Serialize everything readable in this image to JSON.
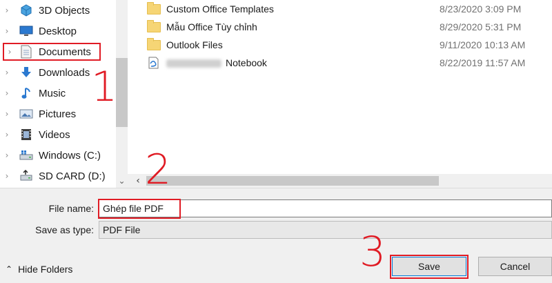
{
  "nav": {
    "items": [
      {
        "label": "3D Objects",
        "icon": "3d-objects-icon"
      },
      {
        "label": "Desktop",
        "icon": "desktop-icon"
      },
      {
        "label": "Documents",
        "icon": "documents-icon"
      },
      {
        "label": "Downloads",
        "icon": "downloads-icon"
      },
      {
        "label": "Music",
        "icon": "music-icon"
      },
      {
        "label": "Pictures",
        "icon": "pictures-icon"
      },
      {
        "label": "Videos",
        "icon": "videos-icon"
      },
      {
        "label": "Windows (C:)",
        "icon": "drive-icon"
      },
      {
        "label": "SD CARD (D:)",
        "icon": "sd-card-icon"
      }
    ],
    "selected": "Documents"
  },
  "files": [
    {
      "name": "Custom Office Templates",
      "date": "8/23/2020 3:09 PM",
      "type": "folder"
    },
    {
      "name": "Mẫu Office Tùy chỉnh",
      "date": "8/29/2020 5:31 PM",
      "type": "folder"
    },
    {
      "name": "Outlook Files",
      "date": "9/11/2020 10:13 AM",
      "type": "folder"
    },
    {
      "name": "Notebook",
      "date": "8/22/2019 11:57 AM",
      "type": "notebook"
    }
  ],
  "form": {
    "file_name_label": "File name:",
    "file_name_value": "Ghép file PDF",
    "save_as_type_label": "Save as type:",
    "save_as_type_value": "PDF File",
    "hide_folders": "Hide Folders",
    "save": "Save",
    "cancel": "Cancel"
  },
  "annotations": [
    "1",
    "2",
    "3"
  ],
  "colors": {
    "annotation_red": "#e01b24",
    "folder_yellow": "#f6d575",
    "dialog_bg": "#f0f0f0",
    "save_border": "#0078d7"
  }
}
